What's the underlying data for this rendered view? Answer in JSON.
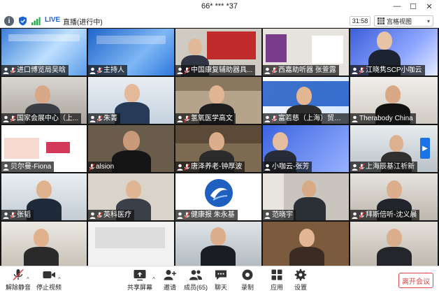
{
  "window": {
    "title": "66* *** *37",
    "minimize_label": "—",
    "maximize_label": "☐",
    "close_label": "✕"
  },
  "status_bar": {
    "info_icon": "info-icon",
    "info_glyph": "i",
    "live_label": "LIVE",
    "live_status": "直播(进行中)",
    "timer": "31:58",
    "view_label": "宫格视图",
    "view_caret": "▾"
  },
  "participants": [
    {
      "name": "进口博览局吴晗"
    },
    {
      "name": "主持人"
    },
    {
      "name": "中国康复辅助器具..."
    },
    {
      "name": "西嘉助听器 张萱露"
    },
    {
      "name": "江晓隽SCP小咖云"
    },
    {
      "name": "国家会展中心（上..."
    },
    {
      "name": "朱菁"
    },
    {
      "name": "氢氧医学高文"
    },
    {
      "name": "富若慈（上海）贸易..."
    },
    {
      "name": "Therabody China"
    },
    {
      "name": "贝尔曼-Fiona"
    },
    {
      "name": "alsion"
    },
    {
      "name": "唐泽养老-钟厚波"
    },
    {
      "name": "小咖云-张芳"
    },
    {
      "name": "上海辰基江祈新"
    },
    {
      "name": "张韬"
    },
    {
      "name": "英科医疗"
    },
    {
      "name": "健康报 朱永基"
    },
    {
      "name": "范晓宇"
    },
    {
      "name": "拜斯倍听-沈义晨"
    }
  ],
  "grid_arrow": "▶",
  "toolbar": {
    "mute_label": "解除静音",
    "video_label": "停止视频",
    "share_label": "共享屏幕",
    "invite_label": "邀请",
    "members_label": "成员(65)",
    "chat_label": "聊天",
    "record_label": "录制",
    "apps_label": "应用",
    "settings_label": "设置",
    "leave_label": "离开会议",
    "caret": "^"
  },
  "colors": {
    "accent": "#1a66d8",
    "danger": "#e04545",
    "toolbar_bg": "#ffffff"
  }
}
